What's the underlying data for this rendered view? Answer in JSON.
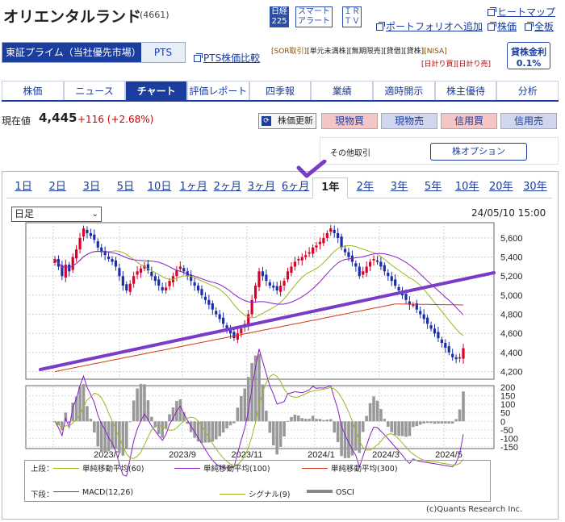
{
  "header": {
    "company_name": "オリエンタルランド",
    "stock_code": "(4661)",
    "nikkei_label_1": "日経",
    "nikkei_label_2": "225",
    "smart_alert_1": "スマート",
    "smart_alert_2": "アラート",
    "ir_1": "ＩＲ",
    "ir_2": "ＴＶ",
    "heatmap": "ヒートマップ",
    "add_portfolio": "ポートフォリオへ追加",
    "stock_price": "株価",
    "full_board": "全板",
    "market_primary": "東証プライム（当社優先市場）",
    "market_pts": "PTS",
    "pts_compare": "PTS株価比較",
    "flags_line1": [
      "[SOR取引]",
      "[単元未満株]",
      "[無期限売]",
      "[貸借]",
      "[貸株]",
      "[NISA]"
    ],
    "flags_line2": [
      "[日計り買]",
      "[日計り売]"
    ],
    "lending_rate_label": "貸株金利",
    "lending_rate_value": "0.1%"
  },
  "tabs": [
    {
      "label": "株価",
      "active": false
    },
    {
      "label": "ニュース",
      "active": false
    },
    {
      "label": "チャート",
      "active": true
    },
    {
      "label": "評価レポート",
      "active": false
    },
    {
      "label": "四季報",
      "active": false
    },
    {
      "label": "業績",
      "active": false
    },
    {
      "label": "適時開示",
      "active": false
    },
    {
      "label": "株主優待",
      "active": false
    },
    {
      "label": "分析",
      "active": false
    }
  ],
  "quote": {
    "label": "現在値",
    "price": "4,445",
    "change": "+116 (+2.68%)",
    "refresh": "株価更新",
    "buttons": [
      "現物買",
      "現物売",
      "信用買",
      "信用売"
    ],
    "other_trading": "その他取引",
    "stock_option": "株オプション"
  },
  "periods": [
    "1日",
    "2日",
    "3日",
    "5日",
    "10日",
    "1ヶ月",
    "2ヶ月",
    "3ヶ月",
    "6ヶ月",
    "1年",
    "2年",
    "3年",
    "5年",
    "10年",
    "20年",
    "30年"
  ],
  "active_period": "1年",
  "chart_controls": {
    "interval_select": "日足",
    "datetime": "24/05/10 15:00"
  },
  "legend": {
    "upper_label": "上段：",
    "lower_label": "下段：",
    "upper": [
      {
        "label": "単純移動平均(60)",
        "color": "#9ab81c"
      },
      {
        "label": "単純移動平均(100)",
        "color": "#8a1ec8"
      },
      {
        "label": "単純移動平均(300)",
        "color": "#d23a1a"
      }
    ],
    "lower": [
      {
        "label": "MACD(12,26)",
        "color": "#8a1ec8"
      },
      {
        "label": "シグナル(9)",
        "color": "#9ab81c"
      },
      {
        "label": "OSCI",
        "color": "#888888"
      }
    ]
  },
  "copyright": "(c)Quants Research Inc.",
  "chart_data": [
    {
      "type": "candlestick",
      "x_tick_labels": [
        "2023/7",
        "2023/9",
        "2023/11",
        "2024/1",
        "2024/3",
        "2024/5"
      ],
      "y_tick_labels": [
        "5,600",
        "5,400",
        "5,200",
        "5,000",
        "4,800",
        "4,600",
        "4,400",
        "4,200"
      ],
      "ylim": [
        4120,
        5760
      ],
      "closes": [
        5380,
        5300,
        5200,
        5320,
        5250,
        5400,
        5480,
        5600,
        5700,
        5650,
        5620,
        5580,
        5500,
        5450,
        5420,
        5380,
        5350,
        5300,
        5200,
        5100,
        5050,
        5120,
        5200,
        5250,
        5280,
        5310,
        5260,
        5200,
        5150,
        5100,
        5050,
        5080,
        5150,
        5200,
        5260,
        5300,
        5250,
        5200,
        5150,
        5100,
        5050,
        5000,
        4950,
        4900,
        4850,
        4800,
        4750,
        4700,
        4650,
        4600,
        4550,
        4600,
        4650,
        4700,
        4800,
        4950,
        5100,
        5250,
        5200,
        5150,
        5100,
        5080,
        5050,
        5100,
        5150,
        5250,
        5300,
        5350,
        5380,
        5400,
        5420,
        5450,
        5500,
        5520,
        5560,
        5600,
        5650,
        5700,
        5650,
        5600,
        5500,
        5450,
        5400,
        5350,
        5300,
        5200,
        5250,
        5300,
        5350,
        5380,
        5350,
        5300,
        5250,
        5200,
        5150,
        5100,
        5050,
        5000,
        4950,
        4900,
        4900,
        4850,
        4800,
        4750,
        4700,
        4650,
        4600,
        4550,
        4500,
        4450,
        4400,
        4350,
        4330,
        4350,
        4445
      ],
      "reference_line": "user-drawn trend line (purple)"
    },
    {
      "type": "line",
      "y_tick_labels": [
        "200",
        "150",
        "100",
        "50",
        "0",
        "-50",
        "-100",
        "-150"
      ],
      "ylim": [
        -160,
        210
      ],
      "series": [
        "MACD(12,26)",
        "シグナル(9)",
        "OSCI"
      ]
    }
  ]
}
